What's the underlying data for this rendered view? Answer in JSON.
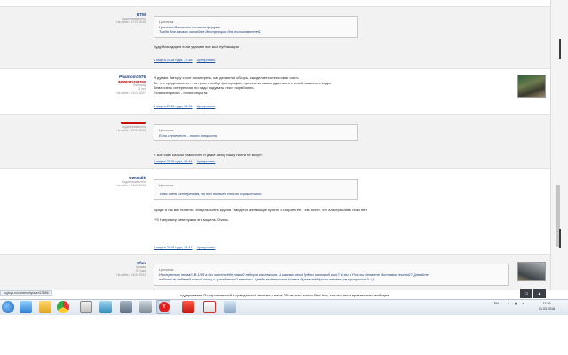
{
  "posts": [
    {
      "user": "RTM",
      "meta": [
        "Ходит неизвестно",
        "На сайте с 27.02.2018"
      ],
      "quote_label": "Цитата:",
      "quote_lines": [
        "Цитата:Я новичок на этом форуме.",
        "Тогда для начала читайте Инструкцию для пользователей."
      ],
      "text": "Буду благодарен если удалите все мои публикации",
      "date": "1 марта 2018 года, 17:48",
      "quote_link": "Цитировать"
    },
    {
      "user": "Phantom1976",
      "role": "администратор",
      "meta": [
        "Новгород",
        "15 лет",
        "На сайте с 15.04.2007"
      ],
      "lines": [
        "Я думаю. Автору стоит посмотреть, как делаются обзоры, как делается текстовая часть",
        "То, что представлено - это просто набор фотографий, причем на самых удачных и с кучей лишнего в кадре.",
        "Тема очень интересная, но надо подумать стоит поработать.",
        "Если интересно - лично открыта."
      ],
      "date": "1 марта 2018 года, 16:34",
      "quote_link": "Цитировать"
    },
    {
      "meta": [
        "Ходит неизвестно",
        "На сайте с 27.02.2018"
      ],
      "quote_label": "Цитата:",
      "quote_lines": [
        "Если интересно - лично открыта."
      ],
      "text": "У Вас сайт сильно наворочен Я даже личку Вашу найти не могу!!!",
      "date": "1 марта 2018 года, 16:44",
      "quote_link": "Цитировать"
    },
    {
      "user": "Gwozdik",
      "meta": [
        "Ходит неизвестно",
        "На сайте с 18.01.2018"
      ],
      "quote_label": "Цитата:",
      "quote_lines": [
        "Тема очень интересная, но над подачей стоит поработать."
      ],
      "lines": [
        "Вроде я так все понятно. Модель очень крутая. Найдутся желающие купить и собрать ее. Тем более, что альтернативы пока нет.",
        "",
        "P.S Например, мне нужна эта модель. Очень."
      ],
      "date": "1 марта 2018 года, 19:47",
      "quote_link": "Цитировать"
    },
    {
      "user": "Sfan",
      "meta": [
        "Москва",
        "52 года",
        "На сайте с 16.09.2012"
      ],
      "quote_label": "Цитата:",
      "quote_lines": [
        "Интересная тема!!! В 1/35 я бы хотел себе такой набор в коллекцию. А какова цена будет за такой кит? И вы в России делаете доставки почтой? Давайте",
        "побольше моделей такой отец и гражданской техники. Среди моделистов Колеса думаю найдутся желающие прикупить!!! =)"
      ]
    }
  ],
  "statusbar": {
    "url": "rugtoys.ru/community/user/23655/",
    "text": "оддерживают По строительной и гражданской технике у нас в 35-ом есть только Red Iron, так что ниша практически свободна"
  },
  "taskbar": {
    "lang": "EN",
    "time": "13:26",
    "date": "01.03.2018"
  }
}
